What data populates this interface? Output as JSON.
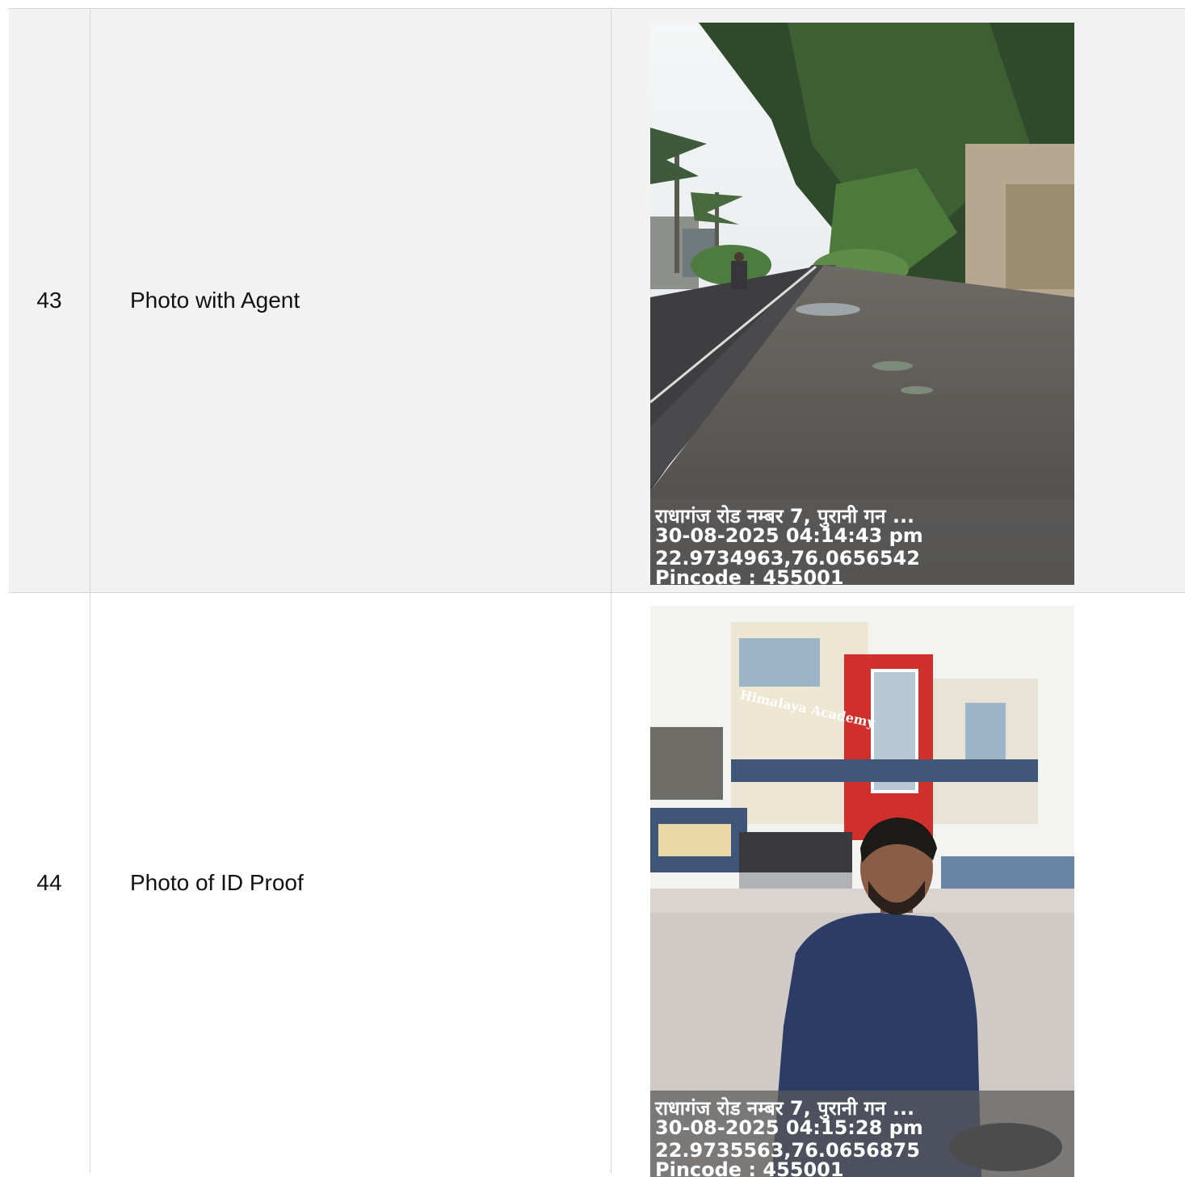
{
  "rows": [
    {
      "number": "43",
      "label": "Photo with Agent",
      "photo": {
        "subject": "street-scene",
        "stamp": {
          "address": "राधागंज रोड नम्बर 7, पुरानी गन ...",
          "datetime": "30-08-2025 04:14:43 pm",
          "coordinates": "22.9734963,76.0656542",
          "pincode": "Pincode : 455001"
        }
      }
    },
    {
      "number": "44",
      "label": "Photo of ID Proof",
      "photo": {
        "subject": "person-in-front-of-building",
        "sign_text": "Himalaya Academy",
        "stamp": {
          "address": "राधागंज रोड नम्बर 7, पुरानी गन ...",
          "datetime": "30-08-2025 04:15:28 pm",
          "coordinates": "22.9735563,76.0656875",
          "pincode": "Pincode : 455001"
        }
      }
    }
  ]
}
